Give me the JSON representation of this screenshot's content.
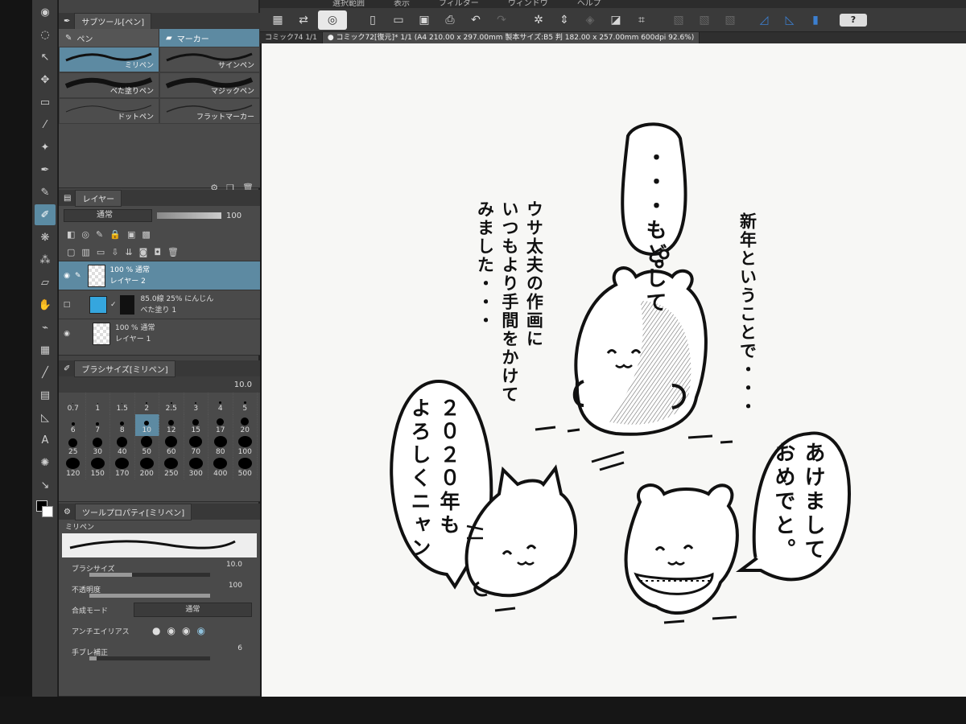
{
  "menu": [
    "選択範囲",
    "表示",
    "フィルター",
    "ウィンドウ",
    "ヘルプ"
  ],
  "doc_tabs": [
    {
      "label": "コミック74",
      "page": "1/1"
    },
    {
      "label": "コミック72[復元]* 1/1 (A4 210.00 x 297.00mm 製本サイズ:B5 判 182.00 x 257.00mm 600dpi 92.6%)"
    }
  ],
  "subtool": {
    "title": "サブツール[ペン]",
    "tabs": [
      "ペン",
      "マーカー"
    ],
    "brushes": [
      "ミリペン",
      "サインペン",
      "べた塗りペン",
      "マジックペン",
      "ドットペン",
      "フラットマーカー"
    ]
  },
  "layer_panel": {
    "title": "レイヤー",
    "blend": "通常",
    "opacity": "100",
    "layers": [
      {
        "line1": "100 % 通常",
        "line2": "レイヤー 2",
        "selected": true
      },
      {
        "line1": "85.0線 25% にんじん",
        "line2": "べた塗り 1",
        "selected": false
      },
      {
        "line1": "100 % 通常",
        "line2": "レイヤー 1",
        "selected": false
      }
    ]
  },
  "brush_size": {
    "title": "ブラシサイズ[ミリペン]",
    "value": "10.0",
    "sizes": [
      "0.7",
      "1",
      "1.5",
      "2",
      "2.5",
      "3",
      "4",
      "5",
      "6",
      "7",
      "8",
      "10",
      "12",
      "15",
      "17",
      "20",
      "25",
      "30",
      "40",
      "50",
      "60",
      "70",
      "80",
      "100",
      "120",
      "150",
      "170",
      "200",
      "250",
      "300",
      "400",
      "500"
    ],
    "selected": "10"
  },
  "tool_property": {
    "title": "ツールプロパティ[ミリペン]",
    "preset": "ミリペン",
    "rows": [
      {
        "name": "ブラシサイズ",
        "value": "10.0",
        "level": 0.35
      },
      {
        "name": "不透明度",
        "value": "100",
        "level": 1.0
      },
      {
        "name": "合成モード",
        "value": "通常"
      },
      {
        "name": "アンチエイリアス",
        "value": ""
      },
      {
        "name": "手ブレ補正",
        "value": "6",
        "level": 0.06
      }
    ]
  },
  "comic": {
    "narration_right": "新年ということで・・・",
    "narration_center": [
      "ウサ太夫の作画に",
      "いつもより手間をかけて",
      "みました・・・"
    ],
    "thought_bubble": "・・・もどして",
    "bubble_left": [
      "２０２０年も",
      "よろしくニャン"
    ],
    "bubble_right": [
      "あけまして",
      "おめでと。"
    ]
  }
}
